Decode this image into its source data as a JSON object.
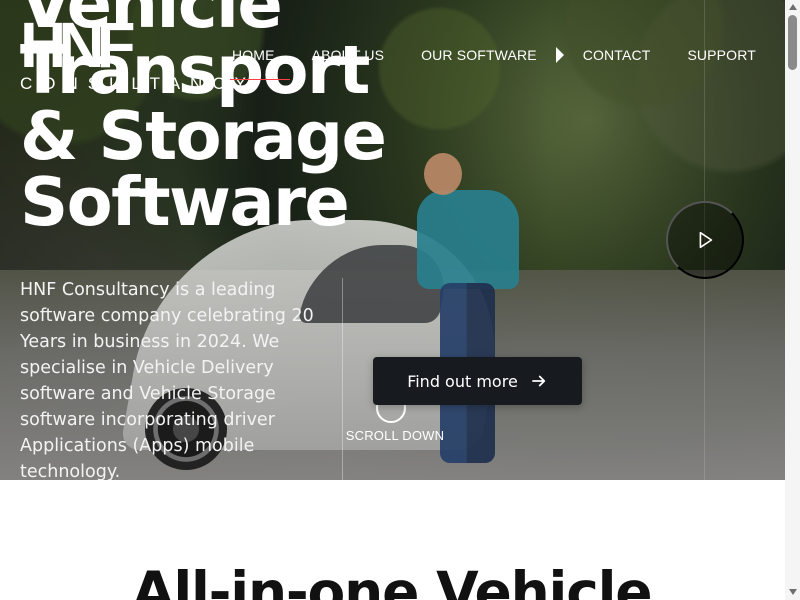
{
  "brand": {
    "logo_mark": "HNF",
    "logo_subtitle": "CONSULTANCY",
    "accent_color": "#ff4145"
  },
  "navigation": {
    "items": [
      {
        "label": "HOME"
      },
      {
        "label": "ABOUT US"
      },
      {
        "label": "OUR SOFTWARE",
        "has_menu": true
      },
      {
        "label": "CONTACT"
      },
      {
        "label": "SUPPORT"
      }
    ],
    "caret_icon": "caret-right-icon"
  },
  "hero": {
    "headline_lines": [
      "Vehicle",
      "Transport",
      "& Storage",
      "Software"
    ],
    "description": "HNF Consultancy is a leading software company celebrating 20 Years in business in 2024. We specialise in Vehicle Delivery software and Vehicle Storage software incorporating driver Applications (Apps) mobile technology.",
    "cta_label": "Find out more",
    "cta_icon": "arrow-right-icon",
    "scroll_label": "SCROLL DOWN",
    "play_icon": "play-icon",
    "colors": {
      "cta_background": "#171b20",
      "text": "#ffffff"
    }
  },
  "next_section": {
    "title": "All-in-one Vehicle"
  },
  "scrollbar": {
    "thumb_position": "top"
  }
}
